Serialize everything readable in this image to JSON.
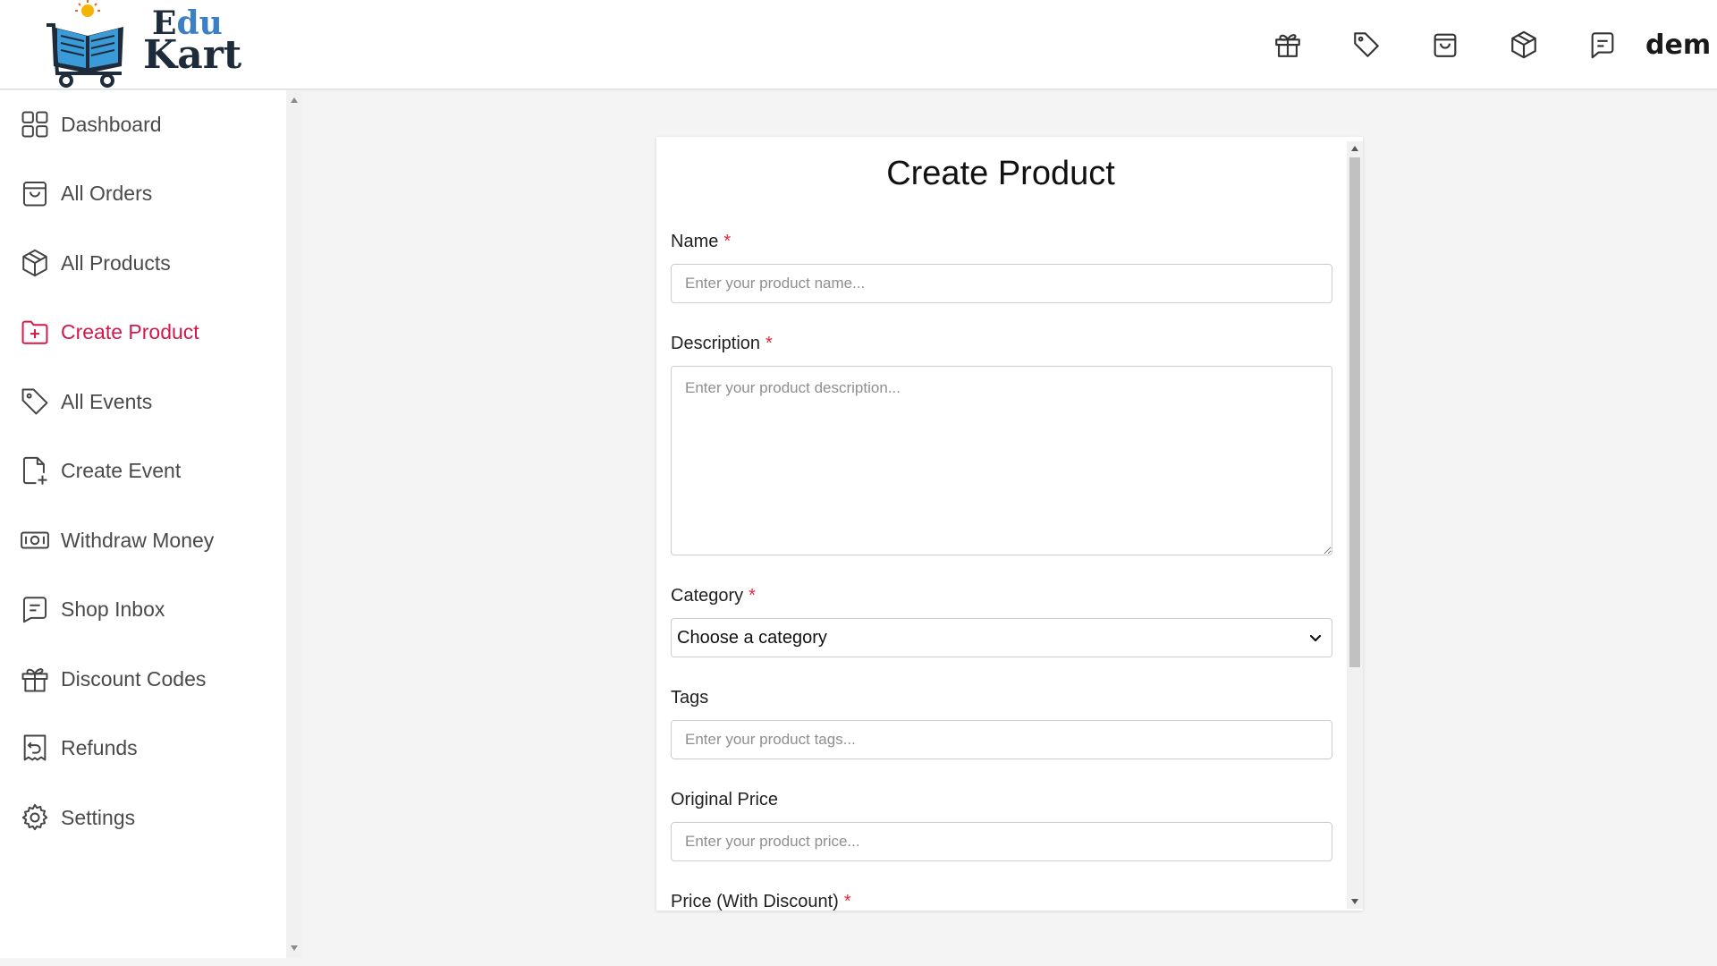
{
  "header": {
    "logo": {
      "line1_first": "E",
      "line1_rest": "du",
      "line2": "Kart"
    },
    "icons": [
      "gift-icon",
      "tag-icon",
      "shopping-bag-icon",
      "box-icon",
      "message-icon"
    ],
    "shop_name": "dem"
  },
  "sidebar": {
    "items": [
      {
        "label": "Dashboard",
        "icon": "grid-icon"
      },
      {
        "label": "All Orders",
        "icon": "shopping-bag-icon"
      },
      {
        "label": "All Products",
        "icon": "box-icon"
      },
      {
        "label": "Create Product",
        "icon": "folder-plus-icon",
        "active": true
      },
      {
        "label": "All Events",
        "icon": "tag-icon"
      },
      {
        "label": "Create Event",
        "icon": "file-plus-icon"
      },
      {
        "label": "Withdraw Money",
        "icon": "money-icon"
      },
      {
        "label": "Shop Inbox",
        "icon": "message-icon"
      },
      {
        "label": "Discount Codes",
        "icon": "gift-icon"
      },
      {
        "label": "Refunds",
        "icon": "refund-icon"
      },
      {
        "label": "Settings",
        "icon": "gear-icon"
      }
    ]
  },
  "form": {
    "title": "Create Product",
    "required_mark": "*",
    "name": {
      "label": "Name",
      "placeholder": "Enter your product name...",
      "required": true
    },
    "description": {
      "label": "Description",
      "placeholder": "Enter your product description...",
      "required": true
    },
    "category": {
      "label": "Category",
      "value": "Choose a category",
      "required": true
    },
    "tags": {
      "label": "Tags",
      "placeholder": "Enter your product tags..."
    },
    "original_price": {
      "label": "Original Price",
      "placeholder": "Enter your product price..."
    },
    "discount_price": {
      "label": "Price (With Discount)",
      "required": true
    }
  },
  "colors": {
    "accent": "#d3184a",
    "required": "#e0263f",
    "logo_blue": "#3b7fc4"
  }
}
